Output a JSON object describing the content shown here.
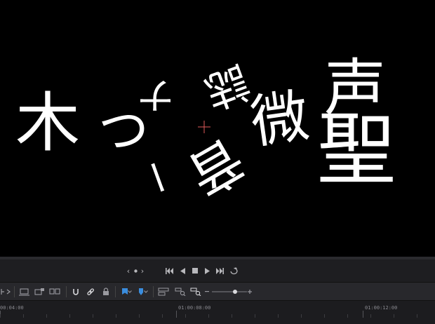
{
  "viewer": {
    "glyphs": [
      "木",
      "つ",
      "ナ",
      "ー",
      "誌",
      "微",
      "声",
      "聖",
      "音"
    ]
  },
  "timeline": {
    "timecodes": [
      "00:04:00",
      "01:00:08:00",
      "01:00:12:00"
    ]
  },
  "colors": {
    "accent_blue": "#3a8dde",
    "crosshair": "#e05a5a",
    "panel_bg": "#1e1e21",
    "toolbar_bg": "#28282c"
  },
  "icons": {
    "transport": [
      "prev-clip-icon",
      "dot-indicator-icon",
      "jump-to-start-icon",
      "play-reverse-icon",
      "stop-icon",
      "play-icon",
      "jump-to-end-icon",
      "loop-icon"
    ],
    "toolbar": [
      "trim-icon",
      "insert-clip-icon",
      "overwrite-clip-icon",
      "replace-clip-icon",
      "snapping-icon",
      "link-icon",
      "lock-icon",
      "flag-icon",
      "marker-icon",
      "zoom-full-icon",
      "zoom-detail-icon",
      "zoom-custom-icon"
    ]
  }
}
